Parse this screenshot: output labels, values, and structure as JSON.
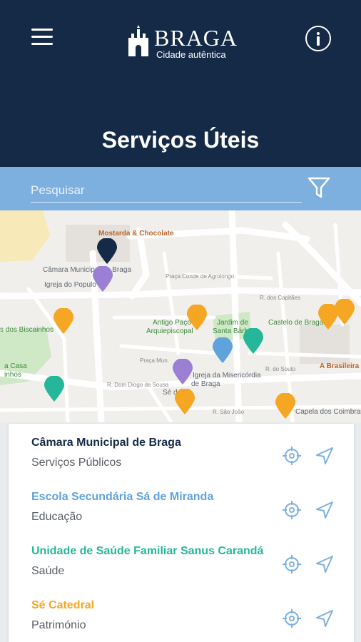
{
  "header": {
    "logo_word": "BRAGA",
    "logo_tagline": "Cidade autêntica",
    "title": "Serviços Úteis",
    "menu_icon": "hamburger-menu-icon",
    "info_icon": "info-icon"
  },
  "search": {
    "placeholder": "Pesquisar",
    "value": "",
    "filter_icon": "filter-funnel-icon"
  },
  "map": {
    "labels": {
      "mostarda": "Mostarda & Chocolate",
      "camara": "Câmara Municipal de Braga",
      "igreja_populo": "Igreja do Populo",
      "praca_conde": "Praça Conde de Agrolongo",
      "capitaes": "R. dos Capitães",
      "biscainhos": "s dos Biscainhos",
      "antigo_paco": "Antigo Paço",
      "arquiepiscopal": "Arquiepiscopal",
      "jardim": "Jardim de",
      "santa_barbara": "Santa Bárbara",
      "castelo": "Castelo de Braga",
      "brasileira": "A Brasileira",
      "casa": "a Casa",
      "nhos": "inhos",
      "misericordia": "Igreja da Misericórdia",
      "de_braga": "de Braga",
      "se": "Sé de",
      "diogo": "R. Dom Diogo de Sousa",
      "capela": "Capela dos Coimbras",
      "souto": "R. do Souto",
      "sao_joao": "R. São João",
      "praca_mun": "Praça Mun."
    },
    "pin_colors": {
      "servicos_publicos": "#142a47",
      "educacao": "#5fa3dc",
      "saude": "#26b79b",
      "patrimonio": "#f5a623",
      "outros": "#9b7fd4"
    }
  },
  "list": [
    {
      "name": "Câmara Municipal de Braga",
      "category": "Serviços Públicos",
      "color": "#142a47"
    },
    {
      "name": "Escola Secundária Sá de Miranda",
      "category": "Educação",
      "color": "#5fa3dc"
    },
    {
      "name": "Unidade de Saúde Familiar Sanus Carandá",
      "category": "Saúde",
      "color": "#26b79b"
    },
    {
      "name": "Sé Catedral",
      "category": "Património",
      "color": "#f5a623"
    }
  ],
  "actions": {
    "locate_icon": "crosshair-locate-icon",
    "navigate_icon": "navigation-arrow-icon"
  }
}
